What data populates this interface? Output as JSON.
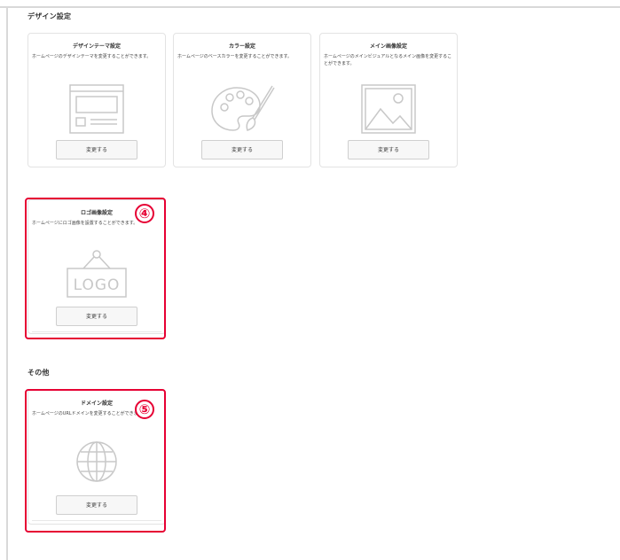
{
  "sections": {
    "design": {
      "title": "デザイン設定"
    },
    "other": {
      "title": "その他"
    }
  },
  "cards": {
    "theme": {
      "title": "デザインテーマ設定",
      "desc": "ホームページのデザインテーマを変更することができます。",
      "button": "変更する",
      "icon": "layout-template-icon"
    },
    "color": {
      "title": "カラー設定",
      "desc": "ホームページのベースカラーを変更することができます。",
      "button": "変更する",
      "icon": "palette-icon"
    },
    "main_image": {
      "title": "メイン画像設定",
      "desc": "ホームページのメインビジュアルとなるメイン画像を変更することができます。",
      "button": "変更する",
      "icon": "picture-icon"
    },
    "logo": {
      "title": "ロゴ画像設定",
      "desc": "ホームページにロゴ画像を設置することができます。",
      "button": "変更する",
      "icon": "logo-sign-icon",
      "icon_text": "LOGO"
    },
    "domain": {
      "title": "ドメイン設定",
      "desc": "ホームページのURLドメインを変更することができます。",
      "button": "変更する",
      "icon": "globe-icon"
    }
  },
  "annotations": {
    "badge_logo": "④",
    "badge_domain": "⑤",
    "highlight_color": "#e60033"
  }
}
